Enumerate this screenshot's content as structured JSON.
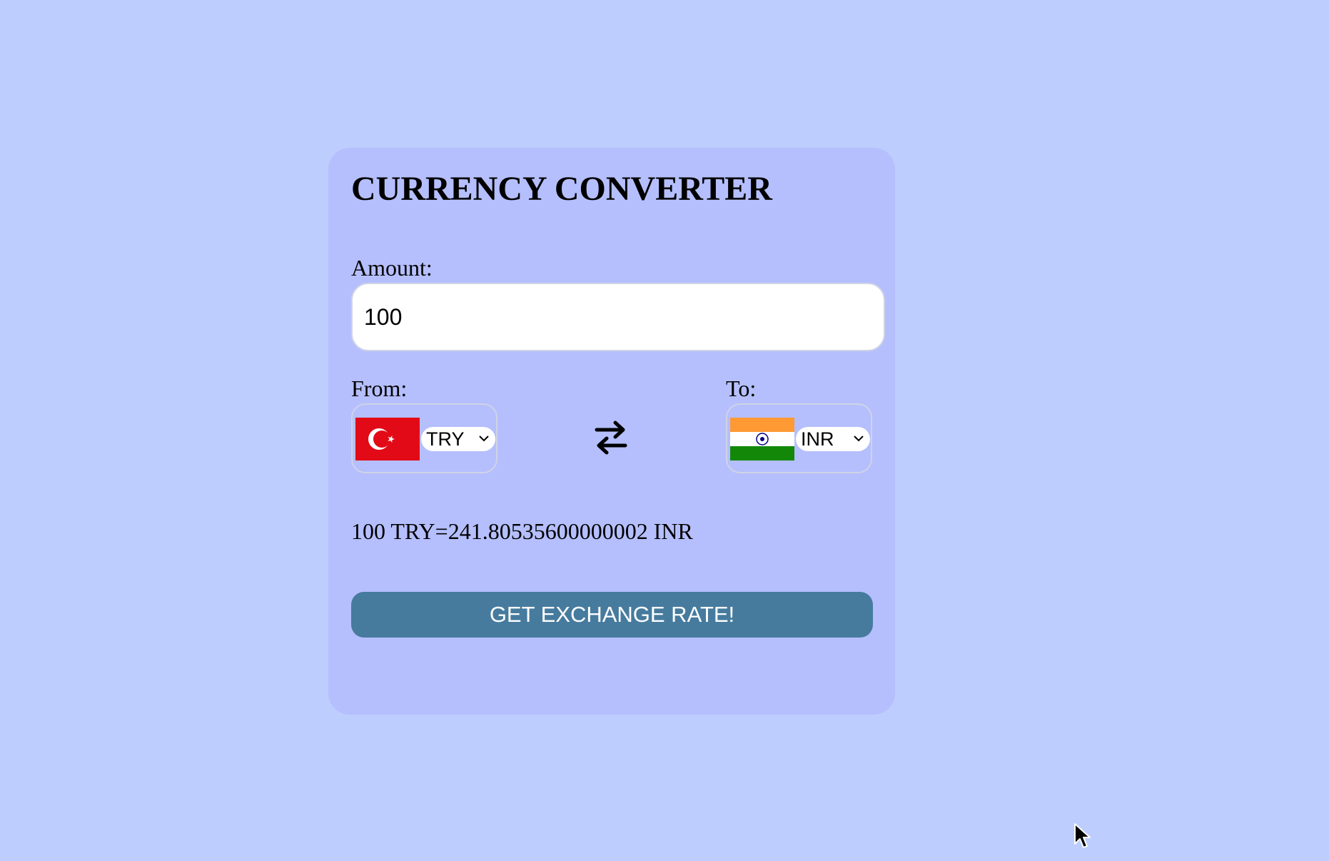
{
  "converter": {
    "title": "CURRENCY CONVERTER",
    "amount_label": "Amount:",
    "amount_value": "100",
    "from_label": "From:",
    "to_label": "To:",
    "from_currency": "TRY",
    "to_currency": "INR",
    "result_text": "100 TRY=241.80535600000002 INR",
    "button_label": "GET EXCHANGE RATE!"
  },
  "icons": {
    "from_flag": "turkey-flag-icon",
    "to_flag": "india-flag-icon",
    "swap": "swap-arrows-icon",
    "dropdown": "chevron-down-icon"
  },
  "colors": {
    "page_background": "#bdcdfe",
    "card_background": "#b5bffd",
    "button_background": "#467b9e",
    "button_text": "#ffffff"
  }
}
